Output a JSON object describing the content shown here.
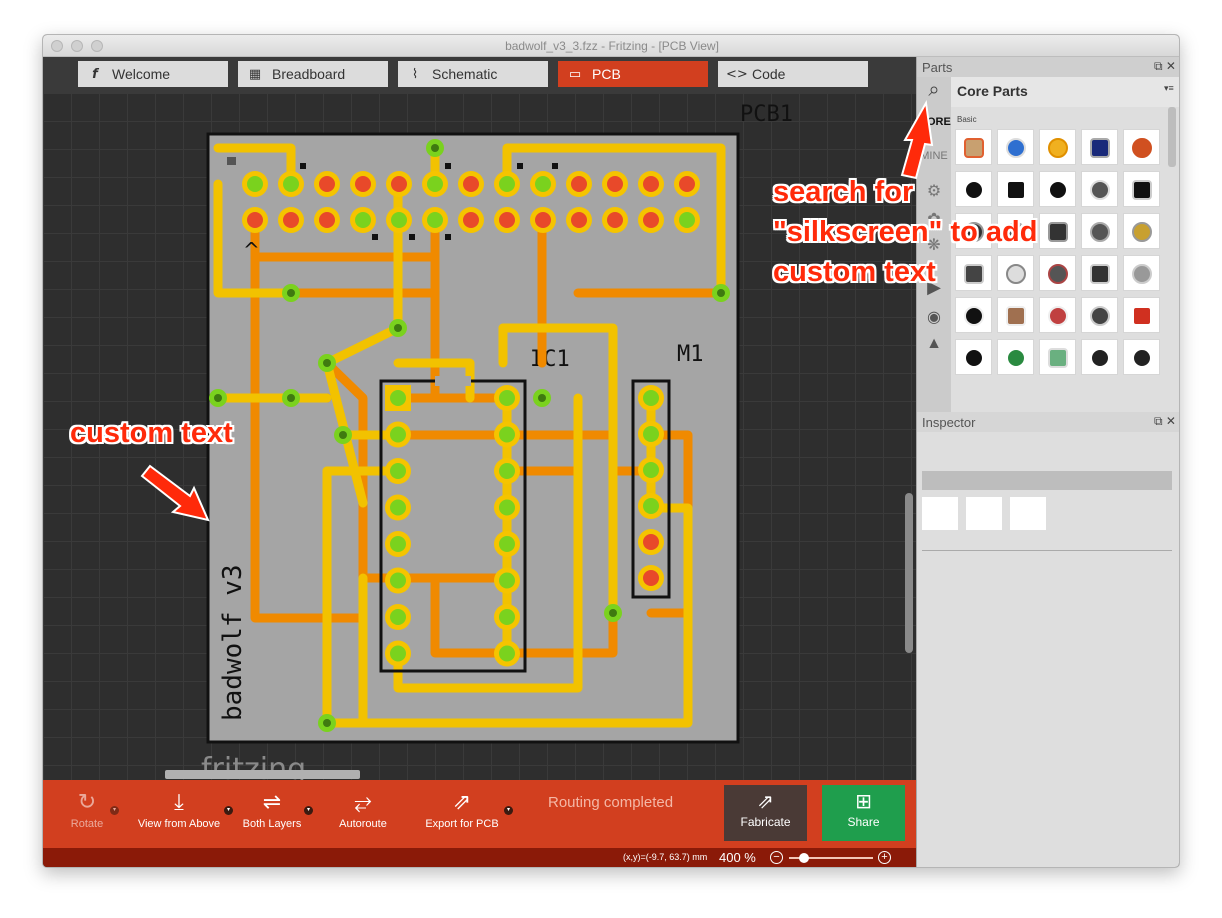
{
  "window": {
    "title": "badwolf_v3_3.fzz - Fritzing - [PCB View]"
  },
  "tabs": [
    {
      "label": "Welcome",
      "icon": "fritzing-f-icon"
    },
    {
      "label": "Breadboard",
      "icon": "breadboard-icon"
    },
    {
      "label": "Schematic",
      "icon": "schematic-icon"
    },
    {
      "label": "PCB",
      "icon": "pcb-icon",
      "active": true
    },
    {
      "label": "Code",
      "icon": "code-icon"
    }
  ],
  "pcb": {
    "board_label": "PCB1",
    "ic_label": "IC1",
    "module_label": "M1",
    "silkscreen_text": "badwolf v3",
    "watermark": "fritzing"
  },
  "toolbar": {
    "rotate": "Rotate",
    "view_from_above": "View from Above",
    "both_layers": "Both Layers",
    "autoroute": "Autoroute",
    "export_for_pcb": "Export for PCB",
    "routing_status": "Routing completed",
    "fabricate": "Fabricate",
    "share": "Share"
  },
  "status": {
    "coords": "(x,y)=(-9.7, 63.7) mm",
    "zoom": "400 %"
  },
  "parts_panel": {
    "title": "Parts",
    "bin_title": "Core Parts",
    "section": "Basic",
    "side_tabs": [
      "CORE",
      "MINE"
    ]
  },
  "inspector": {
    "title": "Inspector"
  },
  "annotations": {
    "search_hint_line1": "search for",
    "search_hint_line2": "\"silkscreen\" to add",
    "search_hint_line3": "custom text",
    "custom_text": "custom text"
  },
  "colors": {
    "accent": "#d23f1f",
    "trace_top": "#f2c200",
    "trace_bottom": "#f08a00",
    "board": "#a5a5a5",
    "share_green": "#1f9e4d",
    "fabricate": "#4a3a36"
  }
}
